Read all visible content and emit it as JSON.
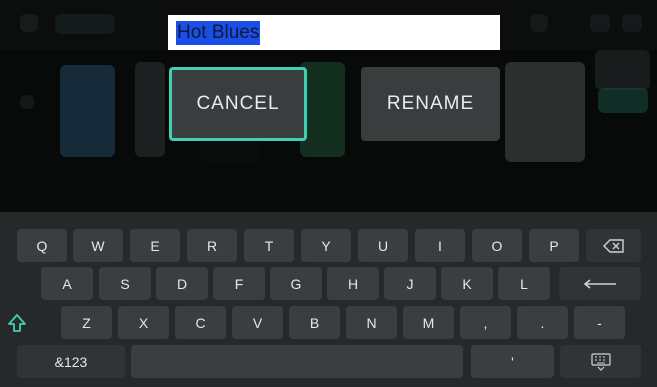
{
  "rename_field": {
    "value": "Hot Blues"
  },
  "dialog": {
    "cancel_label": "CANCEL",
    "rename_label": "RENAME"
  },
  "keyboard": {
    "row1": [
      "Q",
      "W",
      "E",
      "R",
      "T",
      "Y",
      "U",
      "I",
      "O",
      "P"
    ],
    "row2": [
      "A",
      "S",
      "D",
      "F",
      "G",
      "H",
      "J",
      "K",
      "L"
    ],
    "row3": [
      "Z",
      "X",
      "C",
      "V",
      "B",
      "N",
      "M",
      ",",
      ".",
      "-"
    ],
    "symbols_label": "&123",
    "apostrophe": "'",
    "icons": {
      "backspace": "backspace-icon",
      "enter": "enter-icon",
      "shift": "shift-icon",
      "keyboard": "keyboard-hide-icon"
    },
    "colors": {
      "accent": "#3fd0b4",
      "selection": "#1a4ee6",
      "key": "#3a3e40"
    }
  }
}
